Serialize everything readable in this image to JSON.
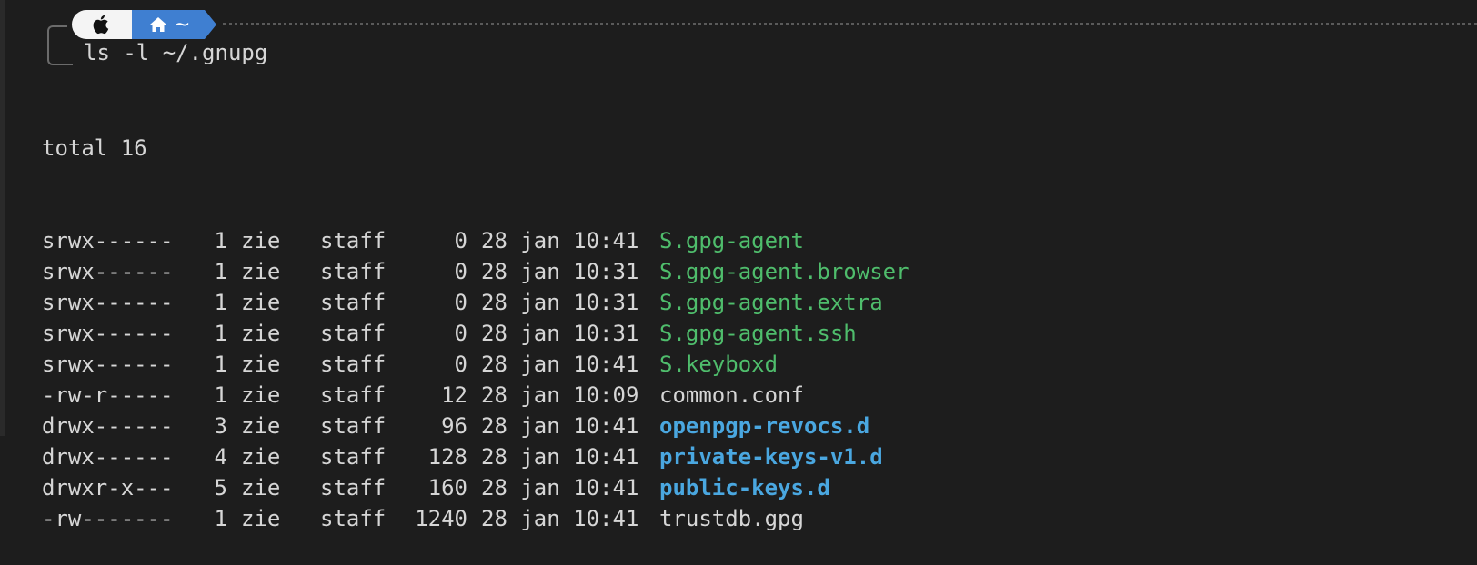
{
  "prompt": {
    "os_icon": "apple-icon",
    "dir_icon": "home-icon",
    "dir": "~",
    "command": "ls -l ~/.gnupg"
  },
  "output": {
    "total": "total 16",
    "rows": [
      {
        "perm": "srwx------",
        "links": "1",
        "user": "zie",
        "group": "staff",
        "size": "0",
        "date": "28 jan 10:41",
        "name": "S.gpg-agent",
        "kind": "socket"
      },
      {
        "perm": "srwx------",
        "links": "1",
        "user": "zie",
        "group": "staff",
        "size": "0",
        "date": "28 jan 10:31",
        "name": "S.gpg-agent.browser",
        "kind": "socket"
      },
      {
        "perm": "srwx------",
        "links": "1",
        "user": "zie",
        "group": "staff",
        "size": "0",
        "date": "28 jan 10:31",
        "name": "S.gpg-agent.extra",
        "kind": "socket"
      },
      {
        "perm": "srwx------",
        "links": "1",
        "user": "zie",
        "group": "staff",
        "size": "0",
        "date": "28 jan 10:31",
        "name": "S.gpg-agent.ssh",
        "kind": "socket"
      },
      {
        "perm": "srwx------",
        "links": "1",
        "user": "zie",
        "group": "staff",
        "size": "0",
        "date": "28 jan 10:41",
        "name": "S.keyboxd",
        "kind": "socket"
      },
      {
        "perm": "-rw-r-----",
        "links": "1",
        "user": "zie",
        "group": "staff",
        "size": "12",
        "date": "28 jan 10:09",
        "name": "common.conf",
        "kind": "file"
      },
      {
        "perm": "drwx------",
        "links": "3",
        "user": "zie",
        "group": "staff",
        "size": "96",
        "date": "28 jan 10:41",
        "name": "openpgp-revocs.d",
        "kind": "dir"
      },
      {
        "perm": "drwx------",
        "links": "4",
        "user": "zie",
        "group": "staff",
        "size": "128",
        "date": "28 jan 10:41",
        "name": "private-keys-v1.d",
        "kind": "dir"
      },
      {
        "perm": "drwxr-x---",
        "links": "5",
        "user": "zie",
        "group": "staff",
        "size": "160",
        "date": "28 jan 10:41",
        "name": "public-keys.d",
        "kind": "dir"
      },
      {
        "perm": "-rw-------",
        "links": "1",
        "user": "zie",
        "group": "staff",
        "size": "1240",
        "date": "28 jan 10:41",
        "name": "trustdb.gpg",
        "kind": "file"
      }
    ]
  },
  "colors": {
    "background": "#1d1d1d",
    "socket": "#4fbd6c",
    "directory": "#4aa7e0",
    "prompt_blue": "#3f7fd1"
  }
}
